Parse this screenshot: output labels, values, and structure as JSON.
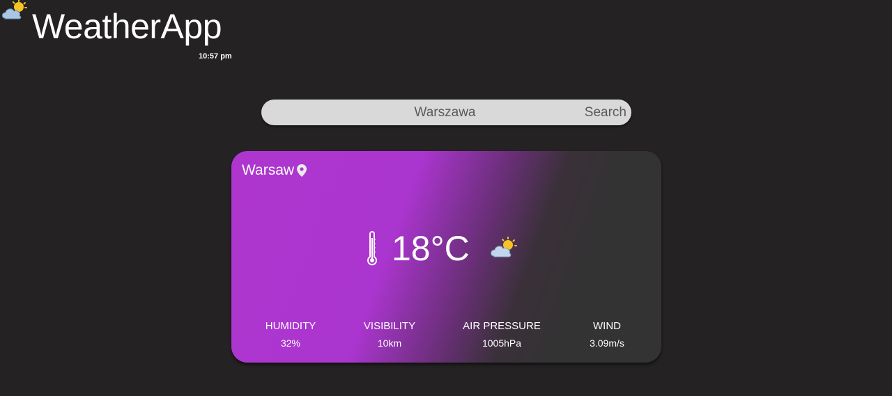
{
  "header": {
    "logo_icon": "cloud-sun-icon",
    "title": "WeatherApp",
    "time": "10:57 pm"
  },
  "search": {
    "value": "Warszawa",
    "button_label": "Search"
  },
  "card": {
    "city": "Warsaw",
    "location_icon": "map-pin-icon",
    "thermometer_icon": "thermometer-icon",
    "temperature": "18°C",
    "condition_icon": "cloud-sun-icon",
    "stats": [
      {
        "label": "HUMIDITY",
        "value": "32%"
      },
      {
        "label": "VISIBILITY",
        "value": "10km"
      },
      {
        "label": "AIR PRESSURE",
        "value": "1005hPa"
      },
      {
        "label": "WIND",
        "value": "3.09m/s"
      }
    ]
  },
  "colors": {
    "background": "#242223",
    "card_gradient_start": "#ae36cf",
    "card_gradient_end": "#333333",
    "search_bg": "#d9d9d9"
  }
}
